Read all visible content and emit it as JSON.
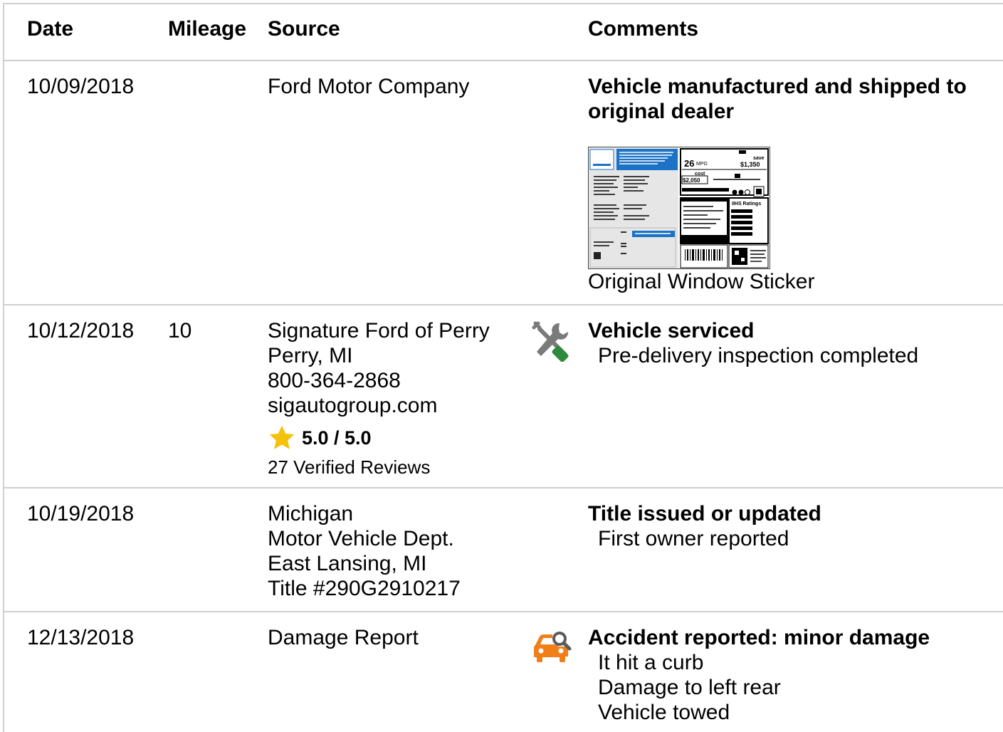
{
  "headers": {
    "date": "Date",
    "mileage": "Mileage",
    "source": "Source",
    "comments": "Comments"
  },
  "records": [
    {
      "date": "10/09/2018",
      "mileage": "",
      "source_lines": [
        "Ford Motor Company"
      ],
      "comment_title_lines": [
        "Vehicle manufactured and shipped to",
        "original dealer"
      ],
      "details": [],
      "sticker_caption": "Original Window Sticker"
    },
    {
      "date": "10/12/2018",
      "mileage": "10",
      "source_lines": [
        "Signature Ford of Perry",
        "Perry, MI",
        "800-364-2868",
        "sigautogroup.com"
      ],
      "rating": "5.0 / 5.0",
      "reviews": "27 Verified Reviews",
      "icon": "wrench-screwdriver-icon",
      "comment_title_lines": [
        "Vehicle serviced"
      ],
      "details": [
        "Pre-delivery inspection completed"
      ]
    },
    {
      "date": "10/19/2018",
      "mileage": "",
      "source_lines": [
        "Michigan",
        "Motor Vehicle Dept.",
        "East Lansing, MI",
        "Title #290G2910217"
      ],
      "comment_title_lines": [
        "Title issued or updated"
      ],
      "details": [
        "First owner reported"
      ]
    },
    {
      "date": "12/13/2018",
      "mileage": "",
      "source_lines": [
        "Damage Report"
      ],
      "icon": "car-damage-search-icon",
      "comment_title_lines": [
        "Accident reported: minor damage"
      ],
      "details": [
        "It hit a curb",
        "Damage to left rear",
        "Vehicle towed"
      ]
    }
  ],
  "sticker_text": {
    "mpg": "26",
    "mpg_unit": "MPG",
    "save_label": "save",
    "save_value": "$1,350",
    "cost_label": "cost",
    "cost_value": "$2,050",
    "iihs": "IIHS Ratings"
  },
  "colors": {
    "tool_green": "#2e8b3e",
    "tool_gray": "#7a7a7a",
    "car_orange": "#f07f1a",
    "star_yellow": "#f4c20d",
    "divider": "#cfcfcf",
    "sticker_blue": "#1c73c6"
  }
}
